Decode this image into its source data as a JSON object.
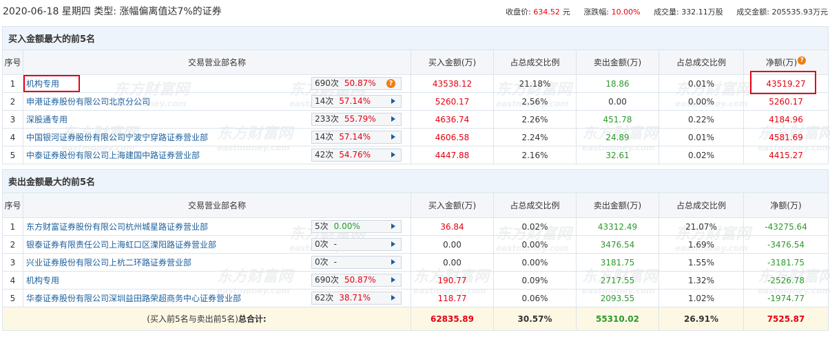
{
  "header": {
    "title": "2020-06-18 星期四  类型: 涨幅偏离值达7%的证券",
    "close_label": "收盘价:",
    "close_value": "634.52",
    "close_unit": "元",
    "change_label": "涨跌幅:",
    "change_value": "10.00%",
    "volume_label": "成交量:",
    "volume_value": "332.11万股",
    "turnover_label": "成交金额:",
    "turnover_value": "205535.93万元"
  },
  "columns": {
    "index": "序号",
    "dept": "交易营业部名称",
    "buy": "买入金额(万)",
    "buy_ratio": "占总成交比例",
    "sell": "卖出金额(万)",
    "sell_ratio": "占总成交比例",
    "net": "净额(万)"
  },
  "buy_section": {
    "title": "买入金额最大的前5名",
    "rows": [
      {
        "idx": "1",
        "name": "机构专用",
        "count": "690次",
        "pct": "50.87%",
        "buy": "43538.12",
        "buy_ratio": "21.18%",
        "sell": "18.86",
        "sell_ratio": "0.01%",
        "net": "43519.27",
        "icon": "question-icon"
      },
      {
        "idx": "2",
        "name": "申港证券股份有限公司北京分公司",
        "count": "14次",
        "pct": "57.14%",
        "buy": "5260.17",
        "buy_ratio": "2.56%",
        "sell": "0.00",
        "sell_ratio": "0.00%",
        "net": "5260.17",
        "icon": "arrow-right-icon"
      },
      {
        "idx": "3",
        "name": "深股通专用",
        "count": "233次",
        "pct": "55.79%",
        "buy": "4636.74",
        "buy_ratio": "2.26%",
        "sell": "451.78",
        "sell_ratio": "0.22%",
        "net": "4184.96",
        "icon": "arrow-right-icon"
      },
      {
        "idx": "4",
        "name": "中国银河证券股份有限公司宁波宁穿路证券营业部",
        "count": "14次",
        "pct": "57.14%",
        "buy": "4606.58",
        "buy_ratio": "2.24%",
        "sell": "24.89",
        "sell_ratio": "0.01%",
        "net": "4581.69",
        "icon": "arrow-right-icon"
      },
      {
        "idx": "5",
        "name": "中泰证券股份有限公司上海建国中路证券营业部",
        "count": "42次",
        "pct": "54.76%",
        "buy": "4447.88",
        "buy_ratio": "2.16%",
        "sell": "32.61",
        "sell_ratio": "0.02%",
        "net": "4415.27",
        "icon": "arrow-right-icon"
      }
    ]
  },
  "sell_section": {
    "title": "卖出金额最大的前5名",
    "rows": [
      {
        "idx": "1",
        "name": "东方财富证券股份有限公司杭州城星路证券营业部",
        "count": "5次",
        "pct": "0.00%",
        "buy": "36.84",
        "buy_ratio": "0.02%",
        "sell": "43312.49",
        "sell_ratio": "21.07%",
        "net": "-43275.64"
      },
      {
        "idx": "2",
        "name": "银泰证券有限责任公司上海虹口区溧阳路证券营业部",
        "count": "0次",
        "pct": "-",
        "buy": "0.00",
        "buy_ratio": "0.00%",
        "sell": "3476.54",
        "sell_ratio": "1.69%",
        "net": "-3476.54"
      },
      {
        "idx": "3",
        "name": "兴业证券股份有限公司上杭二环路证券营业部",
        "count": "0次",
        "pct": "-",
        "buy": "0.00",
        "buy_ratio": "0.00%",
        "sell": "3181.75",
        "sell_ratio": "1.55%",
        "net": "-3181.75"
      },
      {
        "idx": "4",
        "name": "机构专用",
        "count": "690次",
        "pct": "50.87%",
        "buy": "190.77",
        "buy_ratio": "0.09%",
        "sell": "2717.55",
        "sell_ratio": "1.32%",
        "net": "-2526.78"
      },
      {
        "idx": "5",
        "name": "华泰证券股份有限公司深圳益田路荣超商务中心证券营业部",
        "count": "62次",
        "pct": "38.71%",
        "buy": "118.77",
        "buy_ratio": "0.06%",
        "sell": "2093.55",
        "sell_ratio": "1.02%",
        "net": "-1974.77"
      }
    ]
  },
  "total": {
    "label_prefix": "(买入前5名与卖出前5名)",
    "label_bold": "总合计:",
    "buy": "62835.89",
    "buy_ratio": "30.57%",
    "sell": "55310.02",
    "sell_ratio": "26.91%",
    "net": "7525.87"
  },
  "watermark": {
    "cn": "东方财富网",
    "en": "eastmoney.com"
  },
  "colors": {
    "up": "#e4000f",
    "down": "#2a9a2a",
    "link": "#1b5f9e",
    "section_bg": "#eef4fb",
    "total_bg": "#fdf8e4",
    "highlight_box": "#e4000f"
  }
}
